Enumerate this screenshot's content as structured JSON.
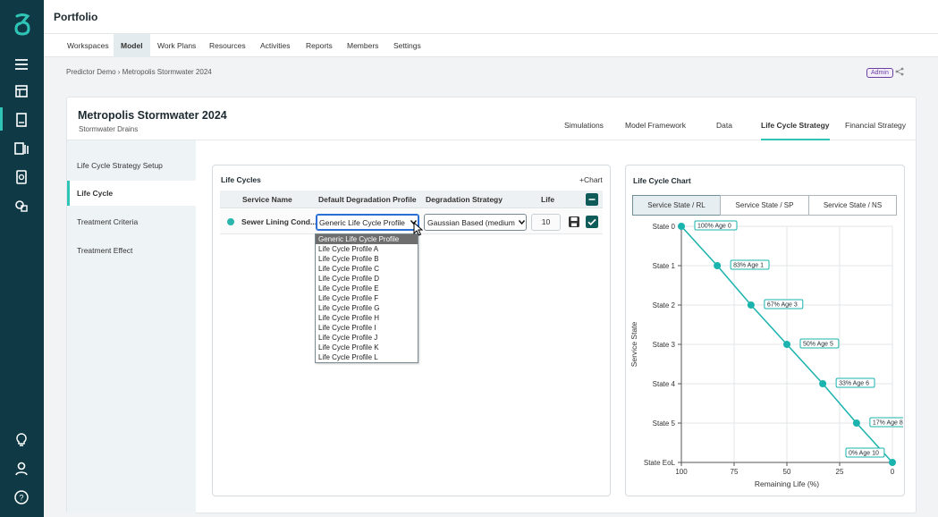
{
  "app": {
    "title": "Portfolio"
  },
  "nav_tabs": [
    "Workspaces",
    "Model",
    "Work Plans",
    "Resources",
    "Activities",
    "Reports",
    "Members",
    "Settings"
  ],
  "breadcrumb": "Predictor Demo › Metropolis Stormwater 2024",
  "badge": "Admin",
  "project": {
    "title": "Metropolis Stormwater 2024",
    "subtitle": "Stormwater Drains"
  },
  "header_tabs": [
    "Simulations",
    "Model Framework",
    "Data",
    "Life Cycle Strategy",
    "Financial Strategy"
  ],
  "side_menu": [
    "Life Cycle Strategy Setup",
    "Life Cycle",
    "Treatment Criteria",
    "Treatment Effect"
  ],
  "life_cycles": {
    "title": "Life Cycles",
    "chart_link": "+Chart",
    "columns": [
      "Service Name",
      "Default Degradation Profile",
      "Degradation Strategy",
      "Life"
    ],
    "row": {
      "service_name": "Sewer Lining Cond...",
      "profile": "Generic Life Cycle Profile",
      "strategy": "Gaussian Based (medium",
      "life": "10"
    },
    "profile_options": [
      "Generic Life Cycle Profile",
      "Life Cycle Profile A",
      "Life Cycle Profile B",
      "Life Cycle Profile C",
      "Life Cycle Profile D",
      "Life Cycle Profile E",
      "Life Cycle Profile F",
      "Life Cycle Profile G",
      "Life Cycle Profile H",
      "Life Cycle Profile I",
      "Life Cycle Profile J",
      "Life Cycle Profile K",
      "Life Cycle Profile L"
    ]
  },
  "chart_panel": {
    "title": "Life Cycle Chart",
    "segments": [
      "Service State / RL",
      "Service State / SP",
      "Service State / NS"
    ]
  },
  "colors": {
    "accent": "#2ec4b6",
    "rail": "#0f3a45",
    "line": "#1ab3ad"
  },
  "chart_data": {
    "type": "line",
    "xlabel": "Remaining Life (%)",
    "ylabel": "Service State",
    "x_ticks": [
      "100",
      "75",
      "50",
      "25",
      "0"
    ],
    "y_ticks": [
      "State 0",
      "State 1",
      "State 2",
      "State 3",
      "State 4",
      "State 5",
      "State EoL"
    ],
    "xlim": [
      100,
      0
    ],
    "grid": true,
    "series": [
      {
        "points": [
          {
            "x": 100,
            "y": 0,
            "label": "100% Age 0"
          },
          {
            "x": 83,
            "y": 1,
            "label": "83% Age 1"
          },
          {
            "x": 67,
            "y": 2,
            "label": "67% Age 3"
          },
          {
            "x": 50,
            "y": 3,
            "label": "50% Age 5"
          },
          {
            "x": 33,
            "y": 4,
            "label": "33% Age 6"
          },
          {
            "x": 17,
            "y": 5,
            "label": "17% Age 8"
          },
          {
            "x": 0,
            "y": 6,
            "label": "0% Age 10"
          }
        ]
      }
    ]
  }
}
